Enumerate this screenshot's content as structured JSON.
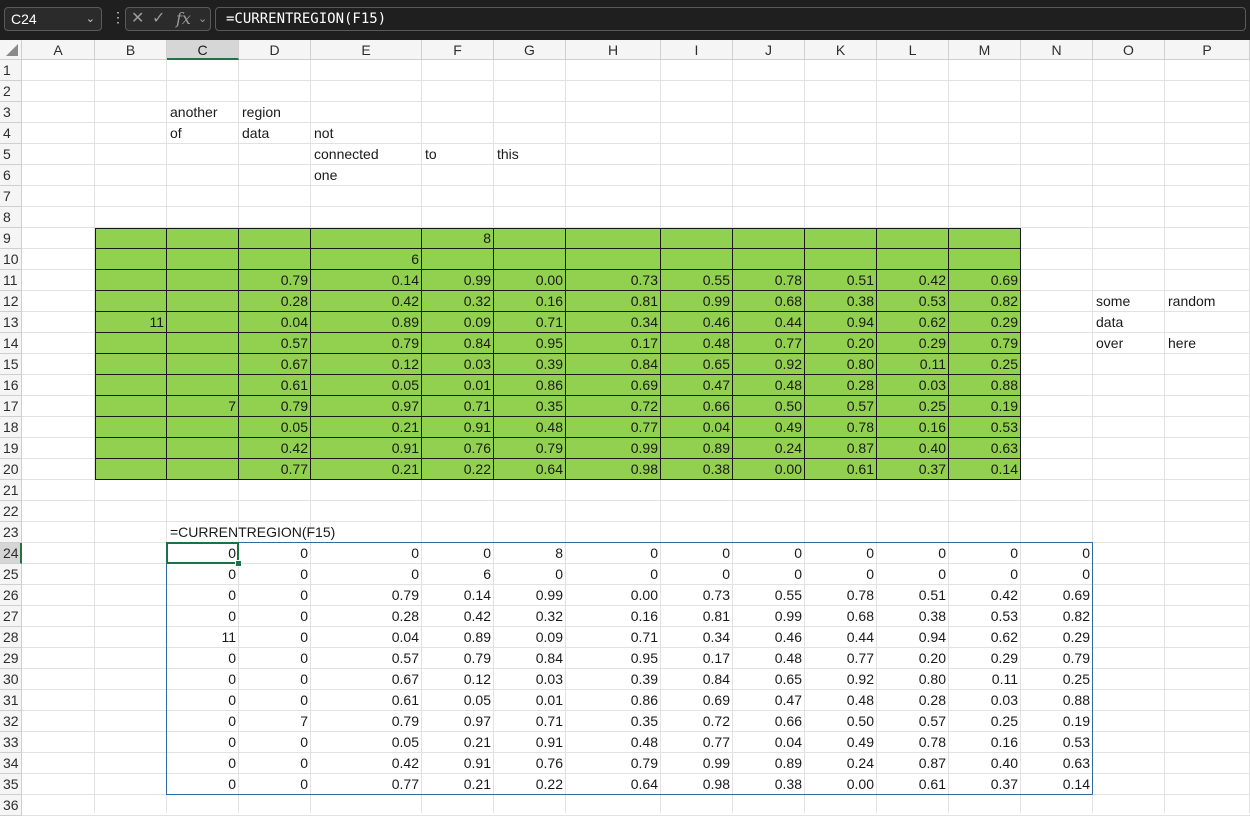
{
  "formula_bar": {
    "name_box": "C24",
    "formula": "=CURRENTREGION(F15)",
    "cancel_icon": "cancel-icon",
    "enter_icon": "check-icon",
    "fx_icon": "fx-icon"
  },
  "columns": [
    "A",
    "B",
    "C",
    "D",
    "E",
    "F",
    "G",
    "H",
    "I",
    "J",
    "K",
    "L",
    "M",
    "N",
    "O",
    "P"
  ],
  "rows": [
    "1",
    "2",
    "3",
    "4",
    "5",
    "6",
    "7",
    "8",
    "9",
    "10",
    "11",
    "12",
    "13",
    "14",
    "15",
    "16",
    "17",
    "18",
    "19",
    "20",
    "21",
    "22",
    "23",
    "24",
    "25",
    "26",
    "27",
    "28",
    "29",
    "30",
    "31",
    "32",
    "33",
    "34",
    "35",
    "36"
  ],
  "selection": {
    "column": "C",
    "row": "24"
  },
  "colors": {
    "region_fill": "#92d050",
    "spill_border": "#2d6ca2",
    "active_border": "#1e7145",
    "header_select": "#217346"
  },
  "texts": {
    "c3": "another",
    "d3": "region",
    "c4": "of",
    "d4": "data",
    "e4": "not",
    "e5": "connected",
    "f5": "to",
    "g5": "this",
    "e6": "one",
    "o12": "some",
    "p12": "random",
    "o13": "data",
    "o14": "over",
    "p14": "here",
    "c23": "=CURRENTREGION(F15)"
  },
  "green_region": {
    "f9": "8",
    "e10": "6",
    "b13": "11",
    "c17": "7",
    "block": [
      [
        "0.79",
        "0.14",
        "0.99",
        "0.00",
        "0.73",
        "0.55",
        "0.78",
        "0.51",
        "0.42",
        "0.69"
      ],
      [
        "0.28",
        "0.42",
        "0.32",
        "0.16",
        "0.81",
        "0.99",
        "0.68",
        "0.38",
        "0.53",
        "0.82"
      ],
      [
        "0.04",
        "0.89",
        "0.09",
        "0.71",
        "0.34",
        "0.46",
        "0.44",
        "0.94",
        "0.62",
        "0.29"
      ],
      [
        "0.57",
        "0.79",
        "0.84",
        "0.95",
        "0.17",
        "0.48",
        "0.77",
        "0.20",
        "0.29",
        "0.79"
      ],
      [
        "0.67",
        "0.12",
        "0.03",
        "0.39",
        "0.84",
        "0.65",
        "0.92",
        "0.80",
        "0.11",
        "0.25"
      ],
      [
        "0.61",
        "0.05",
        "0.01",
        "0.86",
        "0.69",
        "0.47",
        "0.48",
        "0.28",
        "0.03",
        "0.88"
      ],
      [
        "0.79",
        "0.97",
        "0.71",
        "0.35",
        "0.72",
        "0.66",
        "0.50",
        "0.57",
        "0.25",
        "0.19"
      ],
      [
        "0.05",
        "0.21",
        "0.91",
        "0.48",
        "0.77",
        "0.04",
        "0.49",
        "0.78",
        "0.16",
        "0.53"
      ],
      [
        "0.42",
        "0.91",
        "0.76",
        "0.79",
        "0.99",
        "0.89",
        "0.24",
        "0.87",
        "0.40",
        "0.63"
      ],
      [
        "0.77",
        "0.21",
        "0.22",
        "0.64",
        "0.98",
        "0.38",
        "0.00",
        "0.61",
        "0.37",
        "0.14"
      ]
    ]
  },
  "spill": [
    [
      "0",
      "0",
      "0",
      "0",
      "8",
      "0",
      "0",
      "0",
      "0",
      "0",
      "0",
      "0"
    ],
    [
      "0",
      "0",
      "0",
      "6",
      "0",
      "0",
      "0",
      "0",
      "0",
      "0",
      "0",
      "0"
    ],
    [
      "0",
      "0",
      "0.79",
      "0.14",
      "0.99",
      "0.00",
      "0.73",
      "0.55",
      "0.78",
      "0.51",
      "0.42",
      "0.69"
    ],
    [
      "0",
      "0",
      "0.28",
      "0.42",
      "0.32",
      "0.16",
      "0.81",
      "0.99",
      "0.68",
      "0.38",
      "0.53",
      "0.82"
    ],
    [
      "11",
      "0",
      "0.04",
      "0.89",
      "0.09",
      "0.71",
      "0.34",
      "0.46",
      "0.44",
      "0.94",
      "0.62",
      "0.29"
    ],
    [
      "0",
      "0",
      "0.57",
      "0.79",
      "0.84",
      "0.95",
      "0.17",
      "0.48",
      "0.77",
      "0.20",
      "0.29",
      "0.79"
    ],
    [
      "0",
      "0",
      "0.67",
      "0.12",
      "0.03",
      "0.39",
      "0.84",
      "0.65",
      "0.92",
      "0.80",
      "0.11",
      "0.25"
    ],
    [
      "0",
      "0",
      "0.61",
      "0.05",
      "0.01",
      "0.86",
      "0.69",
      "0.47",
      "0.48",
      "0.28",
      "0.03",
      "0.88"
    ],
    [
      "0",
      "7",
      "0.79",
      "0.97",
      "0.71",
      "0.35",
      "0.72",
      "0.66",
      "0.50",
      "0.57",
      "0.25",
      "0.19"
    ],
    [
      "0",
      "0",
      "0.05",
      "0.21",
      "0.91",
      "0.48",
      "0.77",
      "0.04",
      "0.49",
      "0.78",
      "0.16",
      "0.53"
    ],
    [
      "0",
      "0",
      "0.42",
      "0.91",
      "0.76",
      "0.79",
      "0.99",
      "0.89",
      "0.24",
      "0.87",
      "0.40",
      "0.63"
    ],
    [
      "0",
      "0",
      "0.77",
      "0.21",
      "0.22",
      "0.64",
      "0.98",
      "0.38",
      "0.00",
      "0.61",
      "0.37",
      "0.14"
    ]
  ]
}
